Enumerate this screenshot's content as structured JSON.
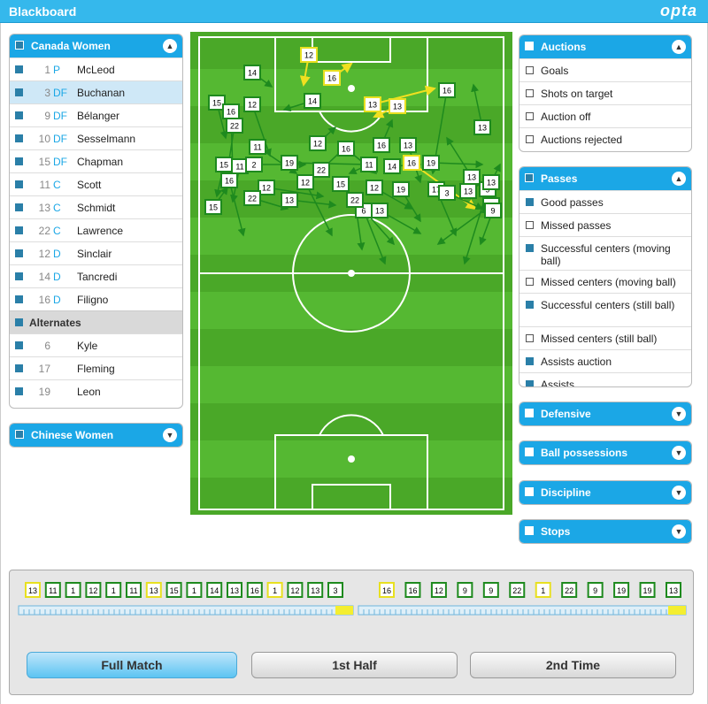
{
  "app": {
    "title": "Blackboard",
    "logo": "opta"
  },
  "teams": {
    "home": {
      "name": "Canada Women",
      "players": [
        {
          "num": "1",
          "pos": "P",
          "name": "McLeod"
        },
        {
          "num": "3",
          "pos": "DF",
          "name": "Buchanan"
        },
        {
          "num": "9",
          "pos": "DF",
          "name": "Bélanger"
        },
        {
          "num": "10",
          "pos": "DF",
          "name": "Sesselmann"
        },
        {
          "num": "15",
          "pos": "DF",
          "name": "Chapman"
        },
        {
          "num": "11",
          "pos": "C",
          "name": "Scott"
        },
        {
          "num": "13",
          "pos": "C",
          "name": "Schmidt"
        },
        {
          "num": "22",
          "pos": "C",
          "name": "Lawrence"
        },
        {
          "num": "12",
          "pos": "D",
          "name": "Sinclair"
        },
        {
          "num": "14",
          "pos": "D",
          "name": "Tancredi"
        },
        {
          "num": "16",
          "pos": "D",
          "name": "Filigno"
        }
      ],
      "alternates_label": "Alternates",
      "alternates": [
        {
          "num": "6",
          "name": "Kyle"
        },
        {
          "num": "17",
          "name": "Fleming"
        },
        {
          "num": "19",
          "name": "Leon"
        }
      ]
    },
    "away": {
      "name": "Chinese Women"
    }
  },
  "filters": {
    "auctions": {
      "title": "Auctions",
      "items": [
        "Goals",
        "Shots on target",
        "Auction off",
        "Auctions rejected"
      ]
    },
    "passes": {
      "title": "Passes",
      "items": [
        {
          "label": "Good passes",
          "checked": true
        },
        {
          "label": "Missed passes",
          "checked": false
        },
        {
          "label": "Successful centers (moving ball)",
          "checked": true
        },
        {
          "label": "Missed centers (moving ball)",
          "checked": false
        },
        {
          "label": "Successful centers (still ball)",
          "checked": true
        },
        {
          "label": "Missed centers (still ball)",
          "checked": false
        },
        {
          "label": "Assists auction",
          "checked": true
        },
        {
          "label": "Assists",
          "checked": true
        }
      ]
    },
    "collapsed": [
      "Defensive",
      "Ball possessions",
      "Discipline",
      "Stops"
    ]
  },
  "pitch": {
    "markers": [
      [
        "14",
        "w"
      ],
      [
        "12",
        "y"
      ],
      [
        "16",
        "y"
      ],
      [
        "14",
        "w"
      ],
      [
        "13",
        "y"
      ],
      [
        "13",
        "y"
      ],
      [
        "16",
        "w"
      ],
      [
        "15",
        "w"
      ],
      [
        "16",
        "w"
      ],
      [
        "12",
        "w"
      ],
      [
        "22",
        "w"
      ],
      [
        "13",
        "w"
      ],
      [
        "11",
        "w"
      ],
      [
        "12",
        "w"
      ],
      [
        "16",
        "w"
      ],
      [
        "16",
        "w"
      ],
      [
        "13",
        "w"
      ],
      [
        "15",
        "w"
      ],
      [
        "11",
        "w"
      ],
      [
        "2",
        "w"
      ],
      [
        "19",
        "w"
      ],
      [
        "22",
        "w"
      ],
      [
        "11",
        "w"
      ],
      [
        "14",
        "w"
      ],
      [
        "16",
        "y"
      ],
      [
        "19",
        "w"
      ],
      [
        "16",
        "w"
      ],
      [
        "12",
        "w"
      ],
      [
        "15",
        "w"
      ],
      [
        "12",
        "w"
      ],
      [
        "13",
        "w"
      ],
      [
        "12",
        "w"
      ],
      [
        "22",
        "w"
      ],
      [
        "13",
        "w"
      ],
      [
        "19",
        "w"
      ],
      [
        "17",
        "w"
      ],
      [
        "3",
        "w"
      ],
      [
        "13",
        "w"
      ],
      [
        "9",
        "w"
      ],
      [
        "9",
        "w"
      ],
      [
        "6",
        "w"
      ],
      [
        "13",
        "w"
      ],
      [
        "22",
        "w"
      ],
      [
        "15",
        "w"
      ],
      [
        "13",
        "w"
      ],
      [
        "9",
        "w"
      ]
    ]
  },
  "timeline": {
    "first_half_chips": [
      "13",
      "11",
      "1",
      "12",
      "1",
      "11",
      "13",
      "15",
      "1",
      "14",
      "13",
      "16",
      "1",
      "12",
      "13",
      "3"
    ],
    "second_half_chips": [
      "16",
      "16",
      "12",
      "9",
      "9",
      "22",
      "1",
      "22",
      "9",
      "19",
      "19",
      "13"
    ]
  },
  "buttons": {
    "full": "Full Match",
    "first": "1st Half",
    "second": "2nd Time"
  },
  "colors": {
    "accent": "#1ba7e6",
    "pitch": "#4caf2a",
    "arrow_green": "#1e8a1e",
    "arrow_yellow": "#f0e020"
  }
}
